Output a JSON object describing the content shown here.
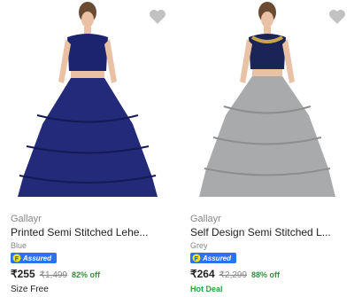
{
  "products": [
    {
      "brand": "Gallayr",
      "title": "Printed Semi Stitched Lehe...",
      "variant": "Blue",
      "assured_label": "Assured",
      "price": "₹255",
      "mrp": "₹1,499",
      "discount": "82% off",
      "extra": "Size Free",
      "skirt_color": "#232a7a",
      "blouse_color": "#1c2470"
    },
    {
      "brand": "Gallayr",
      "title": "Self Design Semi Stitched L...",
      "variant": "Grey",
      "assured_label": "Assured",
      "price": "₹264",
      "mrp": "₹2,299",
      "discount": "88% off",
      "extra": "Hot Deal",
      "skirt_color": "#a9aaac",
      "blouse_color": "#1b2456"
    }
  ],
  "colors": {
    "assured_bg": "#2874f0",
    "discount_green": "#388e3c",
    "hot_deal_green": "#26a541",
    "wishlist_grey": "#c2c2c2"
  },
  "icons": {
    "wishlist": "heart-icon",
    "assured": "flipkart-assured-icon"
  }
}
